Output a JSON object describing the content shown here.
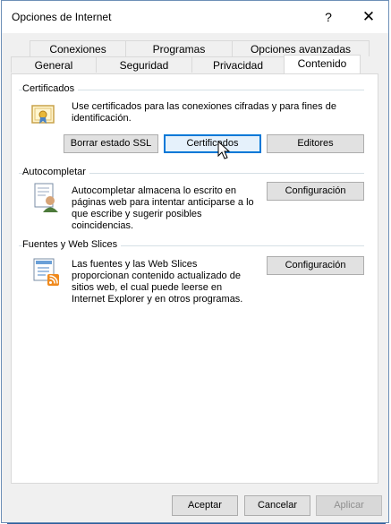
{
  "window": {
    "title": "Opciones de Internet",
    "help_glyph": "?",
    "close_glyph": "✕"
  },
  "tabs_row1": [
    "Conexiones",
    "Programas",
    "Opciones avanzadas"
  ],
  "tabs_row2": [
    "General",
    "Seguridad",
    "Privacidad",
    "Contenido"
  ],
  "active_tab": "Contenido",
  "certificados": {
    "label": "Certificados",
    "text": "Use certificados para las conexiones cifradas y para fines de identificación.",
    "buttons": [
      "Borrar estado SSL",
      "Certificados",
      "Editores"
    ]
  },
  "autocompletar": {
    "label": "Autocompletar",
    "text": "Autocompletar almacena lo escrito en páginas web para intentar anticiparse a lo que escribe y sugerir posibles coincidencias.",
    "button": "Configuración"
  },
  "fuentes": {
    "label": "Fuentes y Web Slices",
    "text": "Las fuentes y las Web Slices proporcionan contenido actualizado de sitios web, el cual puede leerse en Internet Explorer y en otros programas.",
    "button": "Configuración"
  },
  "footer": {
    "accept": "Aceptar",
    "cancel": "Cancelar",
    "apply": "Aplicar"
  },
  "colors": {
    "window_bg": "#f0f0f0",
    "panel_bg": "#ffffff",
    "focus": "#0078d7",
    "backdrop": "#2b5d9b"
  }
}
